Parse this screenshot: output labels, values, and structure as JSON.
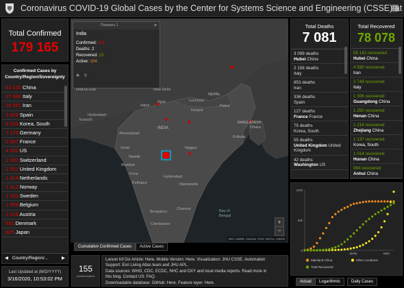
{
  "header": {
    "title": "Coronavirus COVID-19 Global Cases by the Center for Systems Science and Engineering (CSSE) at Jo..."
  },
  "total_confirmed": {
    "label": "Total Confirmed",
    "value": "179 165"
  },
  "country_list": {
    "title_line1": "Confirmed Cases by",
    "title_line2": "Country/Region/Sovereignty",
    "rows": [
      {
        "num": "81 032",
        "name": "China"
      },
      {
        "num": "27 980",
        "name": "Italy"
      },
      {
        "num": "14 991",
        "name": "Iran"
      },
      {
        "num": "9 428",
        "name": "Spain"
      },
      {
        "num": "8 236",
        "name": "Korea, South"
      },
      {
        "num": "7 174",
        "name": "Germany"
      },
      {
        "num": "5 397",
        "name": "France"
      },
      {
        "num": "4 200",
        "name": "US"
      },
      {
        "num": "2 200",
        "name": "Switzerland"
      },
      {
        "num": "1 551",
        "name": "United Kingdom"
      },
      {
        "num": "1 414",
        "name": "Netherlands"
      },
      {
        "num": "1 312",
        "name": "Norway"
      },
      {
        "num": "1 103",
        "name": "Sweden"
      },
      {
        "num": "1 058",
        "name": "Belgium"
      },
      {
        "num": "1 018",
        "name": "Austria"
      },
      {
        "num": "932",
        "name": "Denmark"
      },
      {
        "num": "825",
        "name": "Japan"
      }
    ],
    "footer_label": "Country/Region/..."
  },
  "last_updated": {
    "label": "Last Updated at (M/D/YYYY)",
    "value": "3/16/2020, 10:53:02 PM"
  },
  "popup": {
    "header": "Показать 1",
    "country": "India",
    "confirmed_label": "Confirmed:",
    "confirmed": "119",
    "deaths_label": "Deaths:",
    "deaths": "2",
    "recovered_label": "Recovered:",
    "recovered": "13",
    "active_label": "Active:",
    "active": "104"
  },
  "map": {
    "labels": {
      "pakistan": "PAKISTAN",
      "india": "INDIA",
      "nepal": "NEPAL",
      "bangladesh": "BANGLADESH",
      "bay": "Bay of",
      "bengal": "Bengal",
      "new_delhi": "New Delhi",
      "lucknow": "Lucknow",
      "patna": "Patna",
      "kanpur": "Kanpur",
      "agra": "Agra",
      "jaipur": "Jaipur",
      "hyderabad_pk": "Hyderabad",
      "karachi": "Karachi",
      "ahmedabad": "Ahmedabad",
      "surat": "Surat",
      "nashik": "Nashik",
      "mumbai": "Mumbai",
      "pune": "Pune",
      "nagpur": "Nagpur",
      "hyderabad": "Hyderabad",
      "vijayawada": "Vijayawada",
      "chennai": "Chennai",
      "bengaluru": "Bengaluru",
      "coimbatore": "Coimbatore",
      "dhaka": "Dhaka",
      "kolkata": "Kolkata",
      "kolhapur": "Kolhapur"
    },
    "attribution": "Esri, HERE, Garmin, FAO, NOAA, USGS",
    "tab_active": "Cumulative Confirmed Cases",
    "tab_other": "Active Cases"
  },
  "counter": {
    "value": "155",
    "label": "countries/regions"
  },
  "info": {
    "line1": "Lancet Inf Dis Article: Here. Mobile Version: Here. Visualization: JHU CSSE. Automation",
    "line2": "Support: Esri Living Atlas team and JHU APL.",
    "line3": "Data sources: WHO, CDC, ECDC, NHC and DXY and local media reports. Read more in",
    "line4": "this blog. Contact US: FAQ.",
    "line5": "Downloadable database: GitHub: Here. Feature layer: Here."
  },
  "deaths": {
    "label": "Total Deaths",
    "value": "7 081",
    "rows": [
      {
        "num": "3 099 deaths",
        "place": "Hubei",
        "sub": "China"
      },
      {
        "num": "2 158 deaths",
        "place": "",
        "sub": "Italy"
      },
      {
        "num": "853 deaths",
        "place": "",
        "sub": "Iran"
      },
      {
        "num": "336 deaths",
        "place": "",
        "sub": "Spain"
      },
      {
        "num": "127 deaths",
        "place": "France",
        "sub": "France"
      },
      {
        "num": "75 deaths",
        "place": "",
        "sub": "Korea, South"
      },
      {
        "num": "55 deaths",
        "place": "United Kingdom",
        "sub": "United Kingdom"
      },
      {
        "num": "42 deaths",
        "place": "Washington",
        "sub": "US"
      }
    ]
  },
  "recovered": {
    "label": "Total Recovered",
    "value": "78 078",
    "rows": [
      {
        "num": "55 142 recovered",
        "place": "Hubei",
        "sub": "China"
      },
      {
        "num": "4 590 recovered",
        "place": "",
        "sub": "Iran"
      },
      {
        "num": "2 749 recovered",
        "place": "",
        "sub": "Italy"
      },
      {
        "num": "1 306 recovered",
        "place": "Guangdong",
        "sub": "China"
      },
      {
        "num": "1 250 recovered",
        "place": "Henan",
        "sub": "China"
      },
      {
        "num": "1 216 recovered",
        "place": "Zhejiang",
        "sub": "China"
      },
      {
        "num": "1 137 recovered",
        "place": "",
        "sub": "Korea, South"
      },
      {
        "num": "1 014 recovered",
        "place": "Hunan",
        "sub": "China"
      },
      {
        "num": "984 recovered",
        "place": "Anhui",
        "sub": "China"
      }
    ]
  },
  "chart_data": {
    "type": "line",
    "yticks": [
      "100k",
      "50k",
      "0"
    ],
    "xticks": [
      "февр.",
      "март"
    ],
    "series": [
      {
        "name": "Mainland China",
        "color": "#f28e1c",
        "values": [
          0,
          1,
          3,
          6,
          12,
          20,
          28,
          37,
          45,
          55,
          60,
          64,
          67,
          70,
          72,
          75,
          77,
          78,
          79,
          80,
          80.5,
          81,
          81,
          81,
          81,
          81,
          81,
          81,
          81,
          81
        ]
      },
      {
        "name": "Other Locations",
        "color": "#f0e22a",
        "values": [
          0,
          0,
          0,
          0,
          0,
          0.1,
          0.1,
          0.2,
          0.3,
          0.4,
          0.5,
          0.7,
          1,
          1.5,
          2,
          3,
          4,
          5,
          7,
          9,
          12,
          15,
          19,
          24,
          30,
          38,
          48,
          60,
          80,
          97
        ]
      },
      {
        "name": "Total Recovered",
        "color": "#70a800",
        "values": [
          0,
          0,
          0,
          0,
          0.1,
          0.3,
          0.7,
          1.2,
          2,
          3.5,
          5,
          7,
          10,
          14,
          18,
          23,
          28,
          33,
          38,
          43,
          48,
          52,
          56,
          60,
          63,
          66,
          69,
          72,
          75,
          78
        ]
      }
    ],
    "ylim": [
      0,
      100
    ]
  },
  "chart_tabs": {
    "actual": "Actual",
    "log": "Logarithmic",
    "daily": "Daily Cases"
  }
}
